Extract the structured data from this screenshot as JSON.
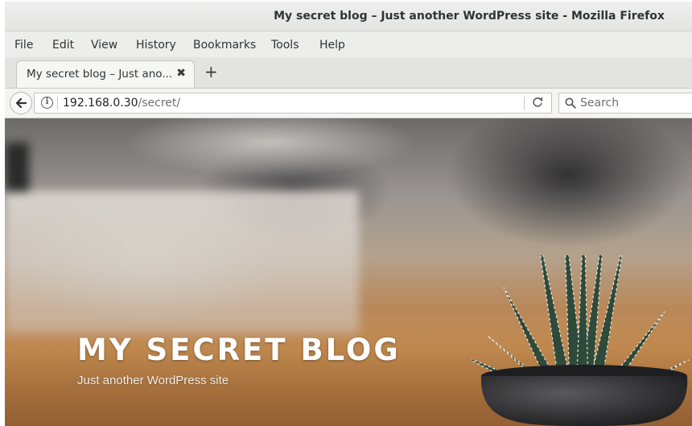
{
  "window": {
    "title": "My secret blog – Just another WordPress site - Mozilla Firefox"
  },
  "menubar": {
    "items": [
      {
        "label": "File"
      },
      {
        "label": "Edit"
      },
      {
        "label": "View"
      },
      {
        "label": "History"
      },
      {
        "label": "Bookmarks"
      },
      {
        "label": "Tools"
      },
      {
        "label": "Help"
      }
    ]
  },
  "tabs": {
    "active": {
      "label": "My secret blog – Just ano...",
      "close_glyph": "✖"
    },
    "new_tab_glyph": "+"
  },
  "navbar": {
    "url_host": "192.168.0.30",
    "url_path": "/secret/",
    "search_placeholder": "Search",
    "reload_glyph": "C",
    "info_glyph": "i"
  },
  "page": {
    "site_title": "MY SECRET BLOG",
    "tagline": "Just another WordPress site"
  },
  "colors": {
    "title_text": "#ffffff",
    "chrome_bg": "#e8e8e7"
  }
}
